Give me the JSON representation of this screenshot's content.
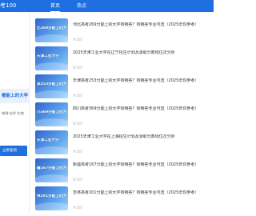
{
  "header": {
    "brand": "考100",
    "tabs": [
      {
        "label": "首页",
        "active": true
      },
      {
        "label": "热点",
        "active": false
      }
    ]
  },
  "colors": {
    "primary": "#1f6fe0",
    "page_bg": "#ffffff",
    "highlight_bg": "#e9f1ff",
    "title_text": "#303133",
    "muted_text": "#b0b3b8"
  },
  "sidebar": {
    "highlight_label": "看能上的大学",
    "sub_label": "物理·化学·生物",
    "button_label": "立即查询"
  },
  "feed": {
    "items": [
      {
        "thumb_text": "北269分能上的大学",
        "title": "河北高考269分能上的大学有哪些？有哪些专业可选（2025年仅参考）",
        "source": "考100"
      },
      {
        "thumb_text": "天津工业大学",
        "title": "2025天津工业大学在辽宁招生计划及录取分数线位次分析",
        "source": "考100"
      },
      {
        "thumb_text": "津253分能上的大学",
        "title": "天津高考253分能上的大学有哪些？有哪些专业可选（2025年仅参考）",
        "source": "考100"
      },
      {
        "thumb_text": "川369分能上的大学",
        "title": "四川高考369分能上的大学有哪些？有哪些专业可选（2025年仅参考）",
        "source": "考100"
      },
      {
        "thumb_text": "天津工业大学",
        "title": "2025天津工业大学在上海招生计划及录取分数线位次分析",
        "source": "考100"
      },
      {
        "thumb_text": "疆167分能上的大学",
        "title": "新疆高考167分能上的大学有哪些？有哪些专业可选（2025年仅参考）",
        "source": "考100"
      },
      {
        "thumb_text": "林201分能上的大学",
        "title": "吉林高考201分能上的大学有哪些？有哪些专业可选（2025年仅参考）",
        "source": "考100"
      }
    ]
  }
}
